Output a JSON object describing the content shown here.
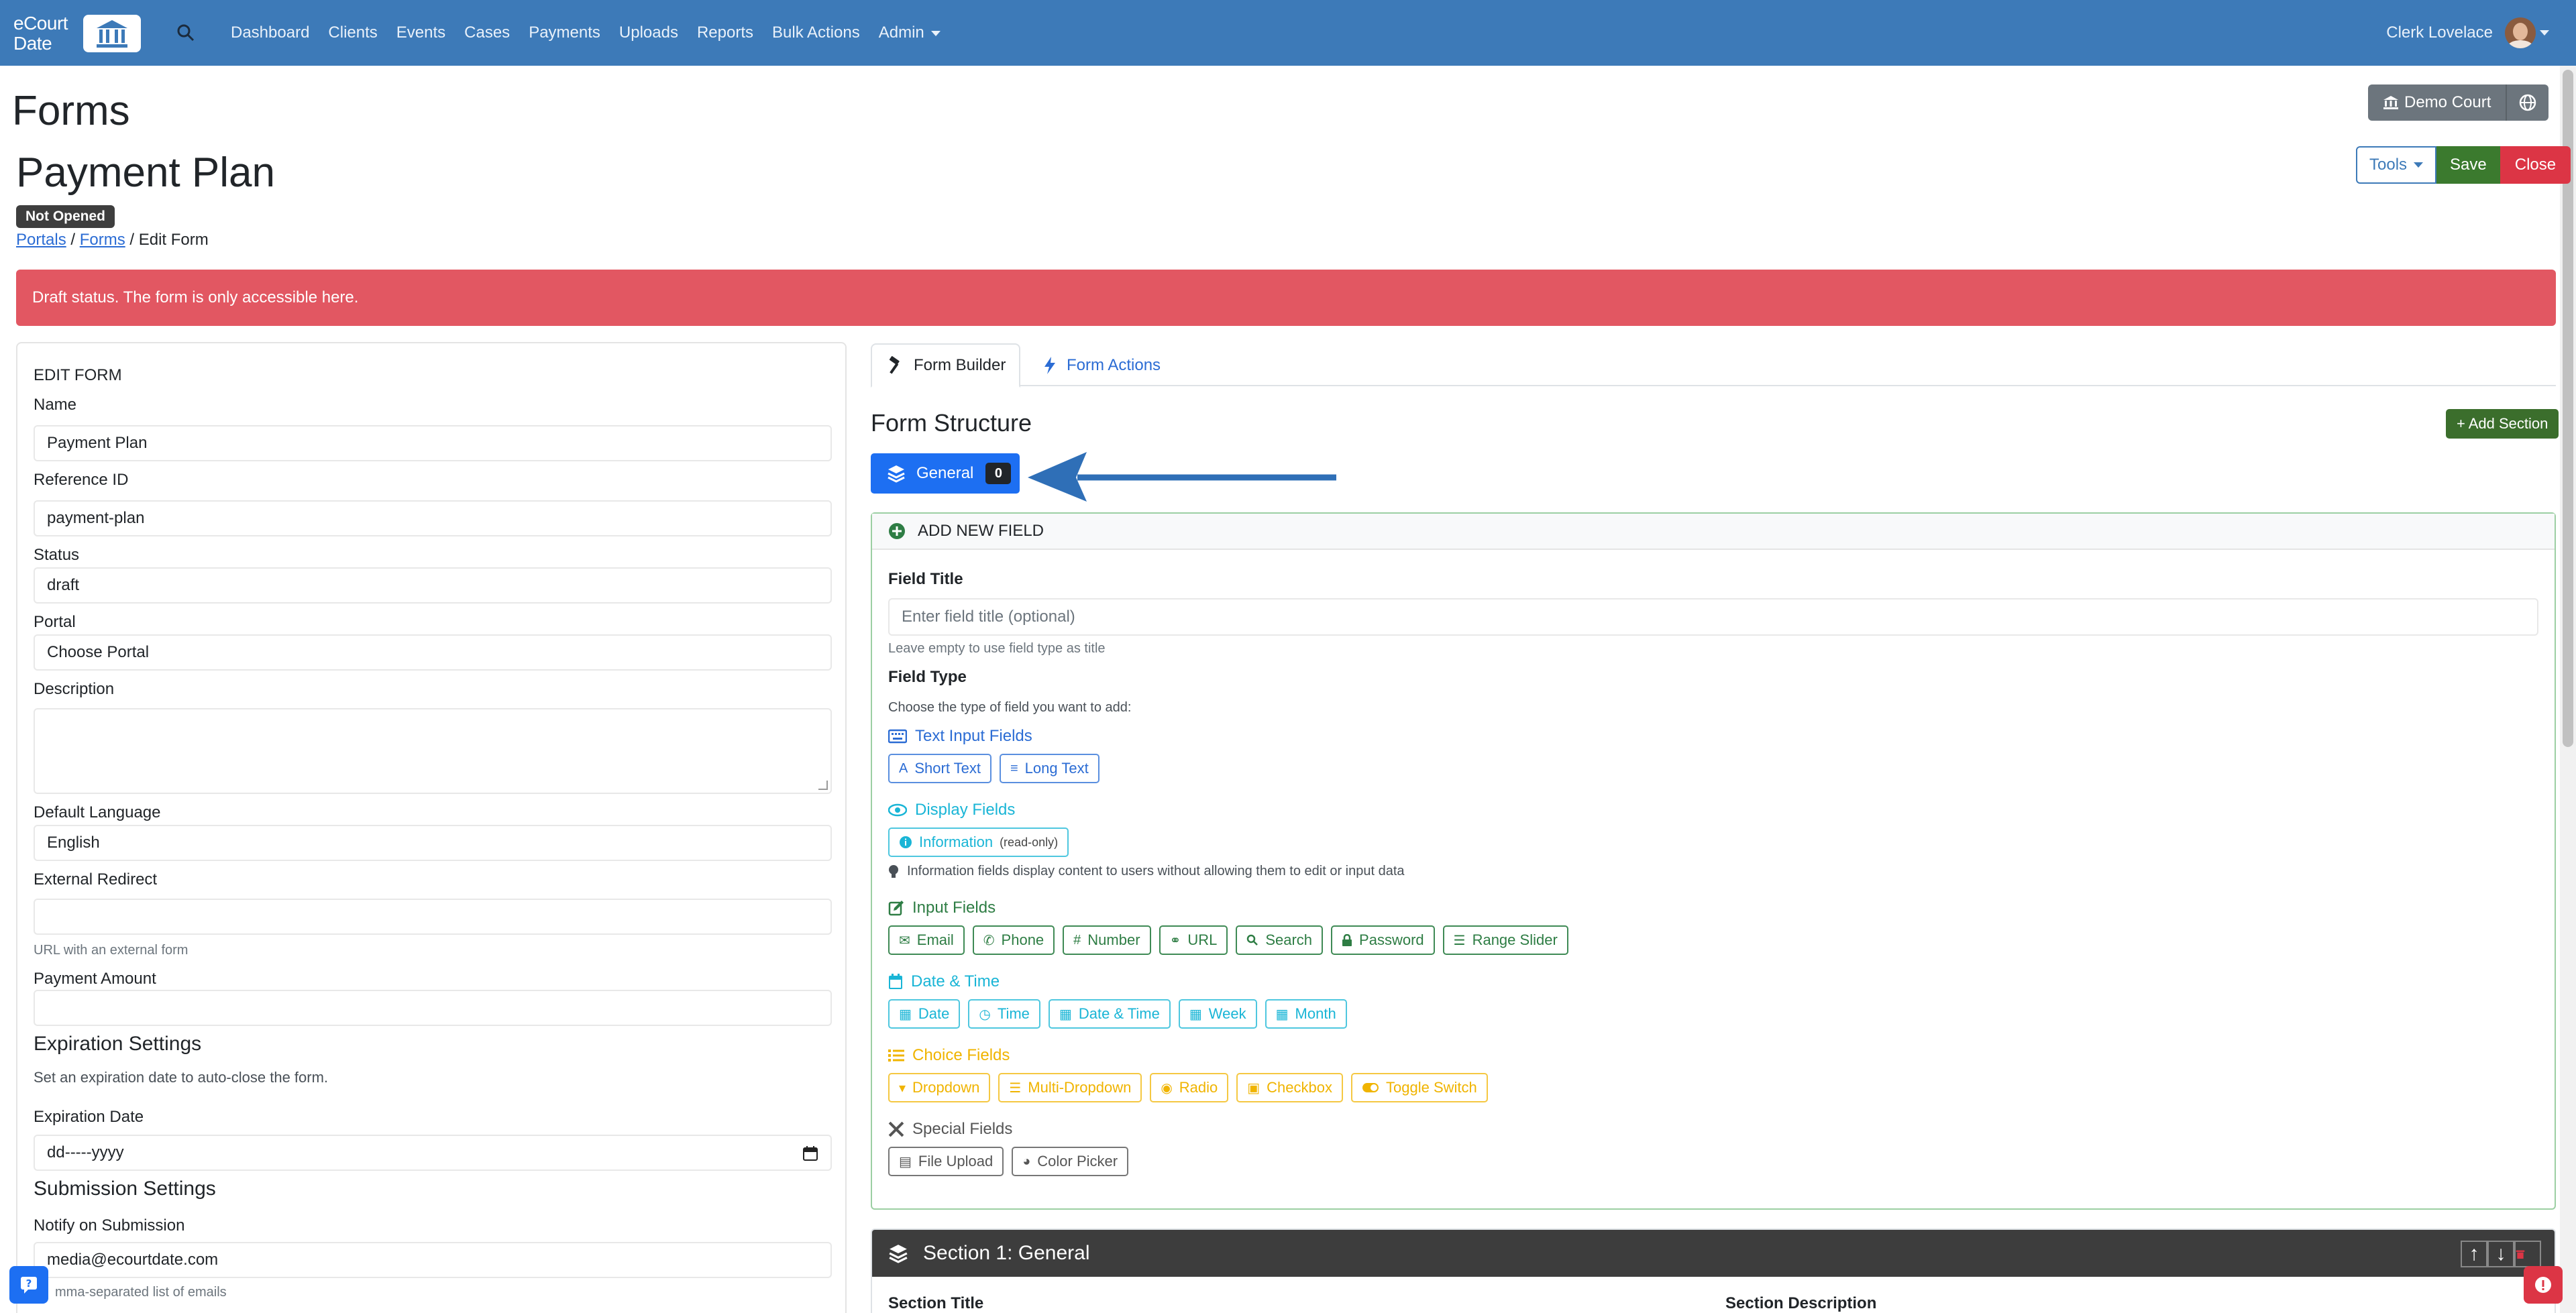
{
  "navbar": {
    "logo_line1": "eCourt",
    "logo_line2": "Date",
    "links": [
      "Dashboard",
      "Clients",
      "Events",
      "Cases",
      "Payments",
      "Uploads",
      "Reports",
      "Bulk Actions",
      "Admin"
    ],
    "user_name": "Clerk Lovelace",
    "icons": {
      "search": "search-icon",
      "logo": "courthouse-icon"
    }
  },
  "page": {
    "title": "Forms",
    "court_label": "Demo Court"
  },
  "form_header": {
    "title": "Payment Plan",
    "status_badge": "Not Opened",
    "breadcrumb": {
      "portals": "Portals",
      "forms": "Forms",
      "current": "Edit Form",
      "sep": "/"
    },
    "tools_label": "Tools",
    "save_label": "Save",
    "close_label": "Close"
  },
  "alert": {
    "text": "Draft status. The form is only accessible here.",
    "color": "#e25762"
  },
  "edit_form": {
    "heading": "EDIT FORM",
    "name_label": "Name",
    "name_value": "Payment Plan",
    "ref_label": "Reference ID",
    "ref_value": "payment-plan",
    "status_label": "Status",
    "status_value": "draft",
    "portal_label": "Portal",
    "portal_value": "Choose Portal",
    "description_label": "Description",
    "description_value": "",
    "language_label": "Default Language",
    "language_value": "English",
    "redirect_label": "External Redirect",
    "redirect_value": "",
    "redirect_help": "URL with an external form",
    "payment_label": "Payment Amount",
    "payment_value": "",
    "expiration_heading": "Expiration Settings",
    "expiration_help": "Set an expiration date to auto-close the form.",
    "expiration_label": "Expiration Date",
    "expiration_value": "dd-----yyyy",
    "submission_heading": "Submission Settings",
    "notify_label": "Notify on Submission",
    "notify_value": "media@ecourtdate.com",
    "notify_help": "mma-separated list of emails"
  },
  "tabs": {
    "builder": "Form Builder",
    "actions": "Form Actions"
  },
  "structure": {
    "title": "Form Structure",
    "add_section": "+ Add Section",
    "general_label": "General",
    "general_count": "0"
  },
  "add_field": {
    "heading": "ADD NEW FIELD",
    "title_label": "Field Title",
    "title_placeholder": "Enter field title (optional)",
    "title_help": "Leave empty to use field type as title",
    "type_label": "Field Type",
    "type_help": "Choose the type of field you want to add:",
    "groups": {
      "text": {
        "title": "Text Input Fields",
        "buttons": [
          "Short Text",
          "Long Text"
        ]
      },
      "display": {
        "title": "Display Fields",
        "buttons": [
          "Information"
        ],
        "readonly": "(read-only)",
        "note": "Information fields display content to users without allowing them to edit or input data"
      },
      "input": {
        "title": "Input Fields",
        "buttons": [
          "Email",
          "Phone",
          "Number",
          "URL",
          "Search",
          "Password",
          "Range Slider"
        ]
      },
      "datetime": {
        "title": "Date & Time",
        "buttons": [
          "Date",
          "Time",
          "Date & Time",
          "Week",
          "Month"
        ]
      },
      "choice": {
        "title": "Choice Fields",
        "buttons": [
          "Dropdown",
          "Multi-Dropdown",
          "Radio",
          "Checkbox",
          "Toggle Switch"
        ]
      },
      "special": {
        "title": "Special Fields",
        "buttons": [
          "File Upload",
          "Color Picker"
        ]
      }
    },
    "colors": {
      "text": "#2b6cd4",
      "display": "#19b5d6",
      "input": "#2e7d44",
      "datetime": "#19b5d6",
      "choice": "#f0b400",
      "special": "#555555"
    }
  },
  "section1": {
    "title": "Section 1: General",
    "title_label": "Section Title",
    "desc_label": "Section Description"
  }
}
